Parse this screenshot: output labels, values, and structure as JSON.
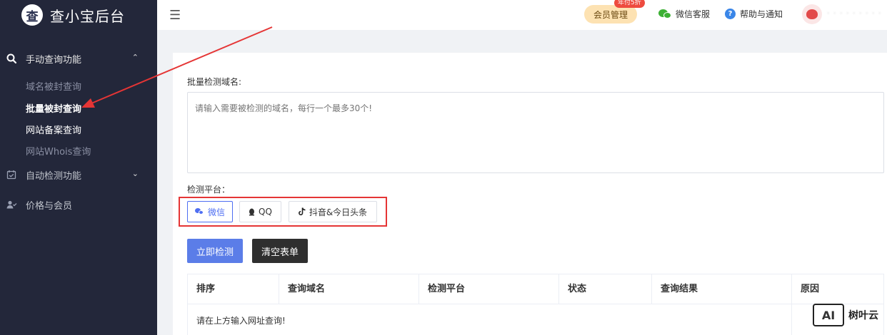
{
  "brand": {
    "logo_char": "查",
    "title": "查小宝后台"
  },
  "sidebar": {
    "groups": [
      {
        "label": "手动查询功能",
        "caret": "⌃"
      },
      {
        "label": "自动检测功能",
        "caret": "⌄"
      },
      {
        "label": "价格与会员"
      }
    ],
    "sub_items": [
      {
        "label": "域名被封查询"
      },
      {
        "label": "批量被封查询"
      },
      {
        "label": "网站备案查询"
      },
      {
        "label": "网站Whois查询"
      }
    ],
    "active_item": "批量被封查询"
  },
  "header": {
    "member_button": "会员管理",
    "badge": "年付5折",
    "wechat_service": "微信客服",
    "help": "帮助与通知",
    "username": "· · · · · · · · ·"
  },
  "form": {
    "domains_label": "批量检测域名:",
    "domains_placeholder": "请输入需要被检测的域名，每行一个最多30个!",
    "platform_label": "检测平台：",
    "platforms": [
      "微信",
      "QQ",
      "抖音&今日头条"
    ],
    "selected_platform": "微信",
    "submit_label": "立即检测",
    "clear_label": "清空表单"
  },
  "table": {
    "columns": [
      "排序",
      "查询域名",
      "检测平台",
      "状态",
      "查询结果",
      "原因"
    ],
    "empty_text": "请在上方输入网址查询!"
  },
  "watermark": {
    "logo": "AI",
    "text": "树叶云"
  },
  "colors": {
    "sidebar_bg": "#23273a",
    "primary": "#5b7de8",
    "highlight_red": "#e53535",
    "member_gold": "#fde2b2"
  }
}
